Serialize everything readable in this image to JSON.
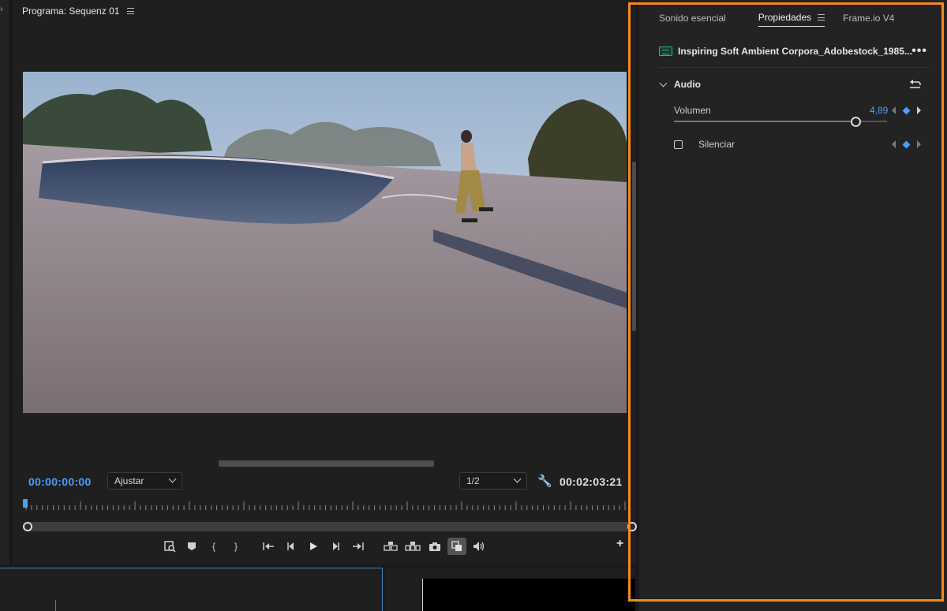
{
  "monitor": {
    "title": "Programa: Sequenz 01",
    "timecode_current": "00:00:00:00",
    "fit_select": "Ajustar",
    "resolution_select": "1/2",
    "timecode_duration": "00:02:03:21"
  },
  "properties": {
    "tabs": [
      {
        "label": "Sonido esencial"
      },
      {
        "label": "Propiedades"
      },
      {
        "label": "Frame.io V4"
      }
    ],
    "clip_name": "Inspiring Soft Ambient Corpora_Adobestock_1985...",
    "section": "Audio",
    "volume": {
      "label": "Volumen",
      "value": "4,89",
      "slider_fraction": 0.85
    },
    "mute": {
      "label": "Silenciar",
      "checked": false
    }
  },
  "colors": {
    "accent": "#4a9fff",
    "highlight_border": "#f5891f",
    "audio_clip": "#2fb38a"
  },
  "icons": {
    "controls": [
      "export-frame-search-icon",
      "marker-icon",
      "mark-in-icon",
      "mark-out-icon",
      "go-to-in-icon",
      "step-back-icon",
      "play-icon",
      "step-forward-icon",
      "go-to-out-icon",
      "lift-icon",
      "extract-icon",
      "camera-icon",
      "comparison-view-icon",
      "volume-icon"
    ]
  }
}
